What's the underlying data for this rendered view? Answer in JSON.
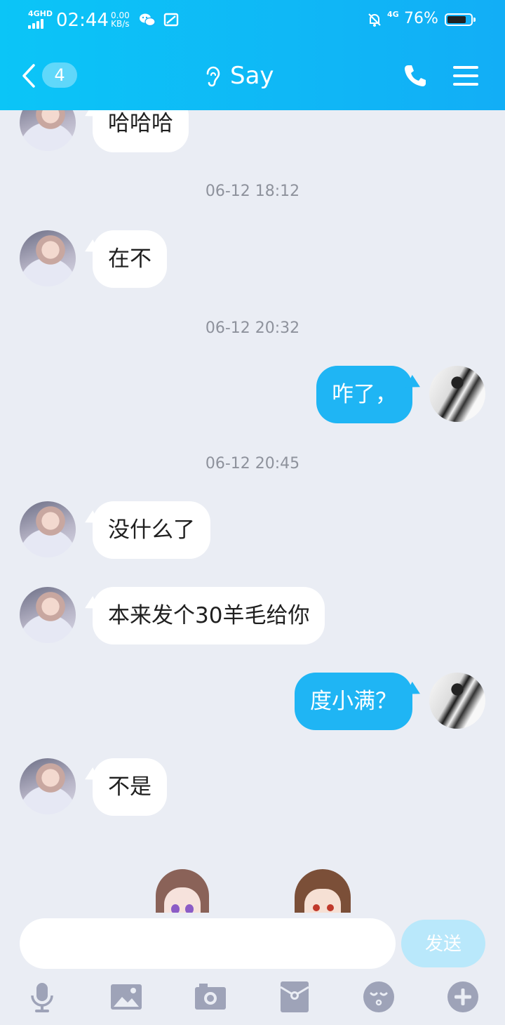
{
  "status_bar": {
    "network": "4GHD",
    "time": "02:44",
    "speed_value": "0.00",
    "speed_unit": "KB/s",
    "network_right": "4G",
    "battery": "76%"
  },
  "header": {
    "back_count": "4",
    "title": "Say"
  },
  "messages": [
    {
      "side": "in",
      "text": "哈哈哈"
    },
    {
      "timestamp": "06-12 18:12"
    },
    {
      "side": "in",
      "text": "在不"
    },
    {
      "timestamp": "06-12 20:32"
    },
    {
      "side": "out",
      "text": "咋了，"
    },
    {
      "timestamp": "06-12 20:45"
    },
    {
      "side": "in",
      "text": "没什么了"
    },
    {
      "side": "in",
      "text": "本来发个30羊毛给你"
    },
    {
      "side": "out",
      "text": "度小满？"
    },
    {
      "side": "in",
      "text": "不是"
    }
  ],
  "input": {
    "value": "",
    "send_label": "发送"
  },
  "toolbar": [
    "microphone-icon",
    "image-icon",
    "camera-icon",
    "red-packet-icon",
    "emoji-icon",
    "plus-icon"
  ],
  "colors": {
    "header": "#12aef6",
    "outgoing_bubble": "#1fb5f4",
    "incoming_bubble": "#ffffff",
    "background": "#eaedf4",
    "send_button": "#b9e8fb",
    "toolbar_icon": "#9ea3b8"
  }
}
